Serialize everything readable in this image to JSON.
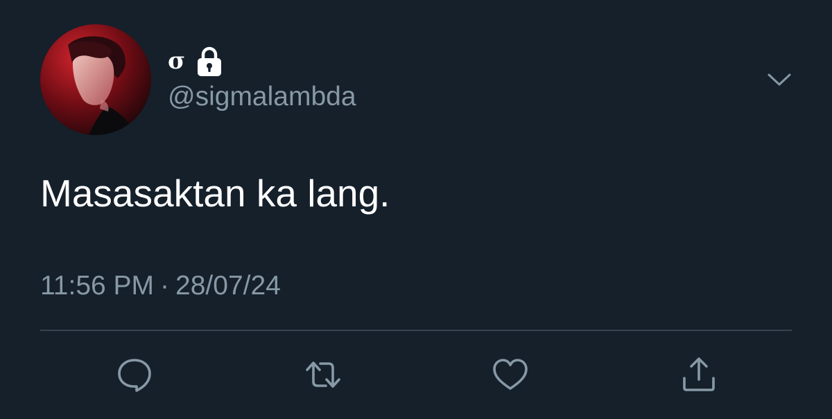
{
  "tweet": {
    "author": {
      "display_name": "σ",
      "handle": "@sigmalambda",
      "protected": true
    },
    "text": "Masasaktan ka lang.",
    "time": "11:56 PM",
    "separator": "·",
    "date": "28/07/24"
  },
  "actions": {
    "reply": "reply-icon",
    "retweet": "retweet-icon",
    "like": "heart-icon",
    "share": "share-icon"
  },
  "colors": {
    "background": "#15202b",
    "primary_text": "#ffffff",
    "secondary_text": "#8899a6",
    "divider": "#38444d"
  }
}
